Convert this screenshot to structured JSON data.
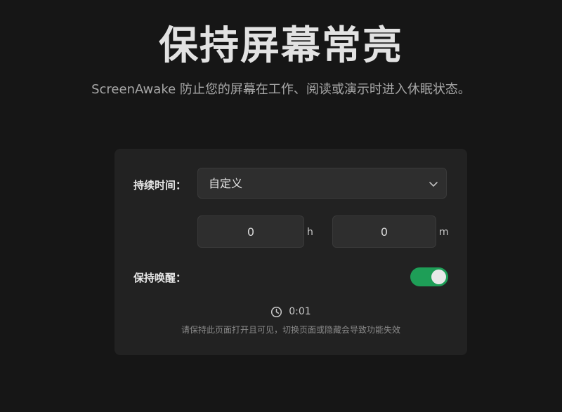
{
  "header": {
    "title": "保持屏幕常亮",
    "subtitle": "ScreenAwake 防止您的屏幕在工作、阅读或演示时进入休眠状态。"
  },
  "settings": {
    "duration_label": "持续时间：",
    "duration_select": {
      "selected": "自定义",
      "icon": "chevron-down-icon"
    },
    "hours": {
      "value": "0",
      "unit": "h"
    },
    "minutes": {
      "value": "0",
      "unit": "m"
    },
    "keep_awake_label": "保持唤醒：",
    "keep_awake_on": true,
    "toggle_color": "#1e9e57"
  },
  "status": {
    "icon": "clock-icon",
    "elapsed": "0:01",
    "note": "请保持此页面打开且可见，切换页面或隐藏会导致功能失效"
  }
}
